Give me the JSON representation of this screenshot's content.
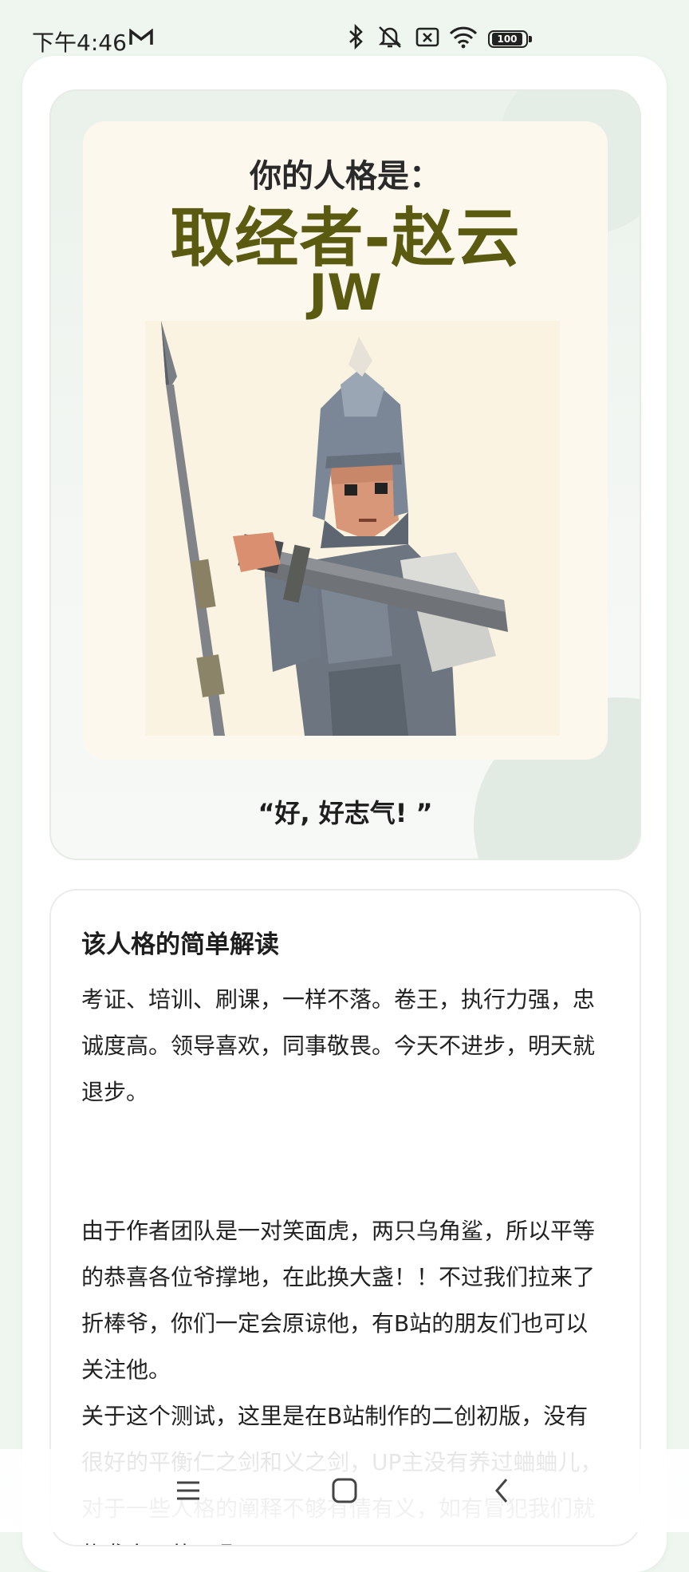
{
  "status_bar": {
    "time": "下午4:46",
    "battery_level": "100",
    "icons": [
      "mail-icon",
      "bluetooth-icon",
      "mute-icon",
      "no-sim-icon",
      "wifi-icon",
      "battery-icon"
    ]
  },
  "result": {
    "subtitle": "你的人格是：",
    "name": "取经者-赵云",
    "code": "JW",
    "quote": "“好, 好志气! ”"
  },
  "description": {
    "title": "该人格的简单解读",
    "paragraphs": [
      "考证、培训、刷课，一样不落。卷王，执行力强，忠诚度高。领导喜欢，同事敬畏。今天不进步，明天就退步。",
      "由于作者团队是一对笑面虎，两只乌角鲨，所以平等的恭喜各位爷撑地，在此换大盏！！不过我们拉来了折棒爷，你们一定会原谅他，有B站的朋友们也可以关注他。",
      "关于这个测试，这里是在B站制作的二创初版，没有很好的平衡仁之剑和义之剑，UP主没有养过蛐蛐儿，对于一些人格的阐释不够有情有义，如有冒犯我们就扎聋自己的耳朵。"
    ]
  },
  "nav": {
    "icons": [
      "menu-icon",
      "home-icon",
      "back-icon"
    ]
  },
  "colors": {
    "accent": "#5a5a10",
    "background": "#eef6ef",
    "poster": "#fdf8ee"
  }
}
